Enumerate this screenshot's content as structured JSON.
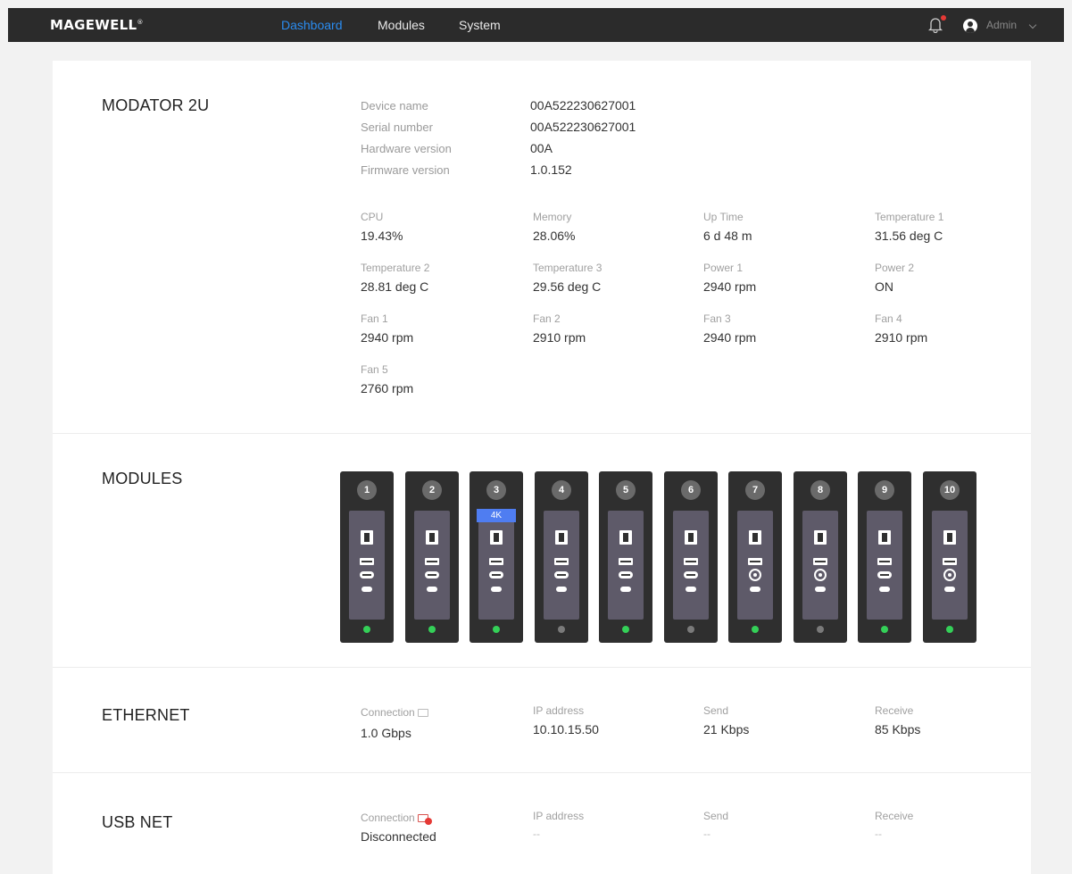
{
  "brand": "MAGEWELL",
  "nav": {
    "dashboard": "Dashboard",
    "modules": "Modules",
    "system": "System"
  },
  "user": {
    "name": "Admin"
  },
  "colors": {
    "topbar": "#2b2b2b",
    "nav_active": "#2a8cf0",
    "led_on": "#34d058",
    "led_off": "#7a7a7a",
    "badge_4k": "#4f7df1"
  },
  "device": {
    "title": "MODATOR 2U",
    "info": [
      {
        "label": "Device name",
        "value": "00A522230627001"
      },
      {
        "label": "Serial number",
        "value": "00A522230627001"
      },
      {
        "label": "Hardware version",
        "value": "00A"
      },
      {
        "label": "Firmware version",
        "value": "1.0.152"
      }
    ],
    "stats": [
      {
        "label": "CPU",
        "value": "19.43%"
      },
      {
        "label": "Memory",
        "value": "28.06%"
      },
      {
        "label": "Up Time",
        "value": "6 d 48 m"
      },
      {
        "label": "Temperature 1",
        "value": "31.56 deg C"
      },
      {
        "label": "Temperature 2",
        "value": "28.81 deg C"
      },
      {
        "label": "Temperature 3",
        "value": "29.56 deg C"
      },
      {
        "label": "Power 1",
        "value": "2940 rpm"
      },
      {
        "label": "Power 2",
        "value": "ON"
      },
      {
        "label": "Fan 1",
        "value": "2940 rpm"
      },
      {
        "label": "Fan 2",
        "value": "2910 rpm"
      },
      {
        "label": "Fan 3",
        "value": "2940 rpm"
      },
      {
        "label": "Fan 4",
        "value": "2910 rpm"
      },
      {
        "label": "Fan 5",
        "value": "2760 rpm"
      }
    ]
  },
  "modules": {
    "title": "MODULES",
    "slots": [
      {
        "number": "1",
        "badge": "",
        "led": "on",
        "port": "usb"
      },
      {
        "number": "2",
        "badge": "",
        "led": "on",
        "port": "usb"
      },
      {
        "number": "3",
        "badge": "4K",
        "led": "on",
        "port": "usb"
      },
      {
        "number": "4",
        "badge": "",
        "led": "off",
        "port": "usb"
      },
      {
        "number": "5",
        "badge": "",
        "led": "on",
        "port": "usb"
      },
      {
        "number": "6",
        "badge": "",
        "led": "off",
        "port": "usb"
      },
      {
        "number": "7",
        "badge": "",
        "led": "on",
        "port": "bnc"
      },
      {
        "number": "8",
        "badge": "",
        "led": "off",
        "port": "bnc"
      },
      {
        "number": "9",
        "badge": "",
        "led": "on",
        "port": "usb"
      },
      {
        "number": "10",
        "badge": "",
        "led": "on",
        "port": "bnc"
      }
    ]
  },
  "ethernet": {
    "title": "ETHERNET",
    "connection_label": "Connection",
    "connection": "1.0 Gbps",
    "ip_label": "IP address",
    "ip": "10.10.15.50",
    "send_label": "Send",
    "send": "21 Kbps",
    "receive_label": "Receive",
    "receive": "85 Kbps"
  },
  "usbnet": {
    "title": "USB NET",
    "connection_label": "Connection",
    "connection": "Disconnected",
    "ip_label": "IP address",
    "ip": "--",
    "send_label": "Send",
    "send": "--",
    "receive_label": "Receive",
    "receive": "--"
  }
}
